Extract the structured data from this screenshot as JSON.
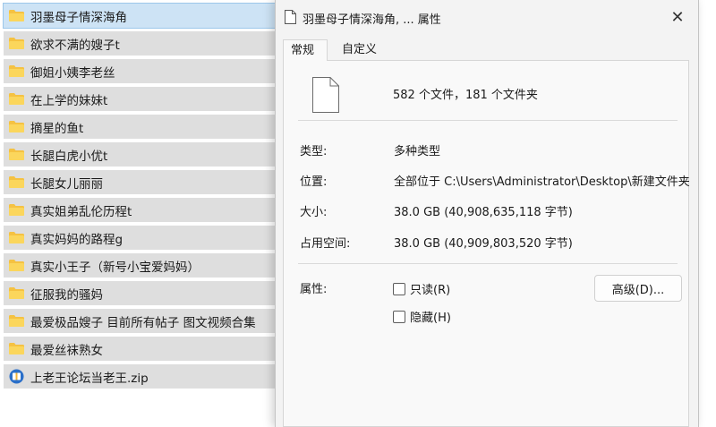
{
  "file_list": [
    {
      "name": "羽墨母子情深海角",
      "type": "folder",
      "selected": true
    },
    {
      "name": "欲求不满的嫂子t",
      "type": "folder"
    },
    {
      "name": "御姐小姨李老丝",
      "type": "folder"
    },
    {
      "name": "在上学的妹妹t",
      "type": "folder"
    },
    {
      "name": "摘星的鱼t",
      "type": "folder"
    },
    {
      "name": "长腿白虎小优t",
      "type": "folder"
    },
    {
      "name": "长腿女儿丽丽",
      "type": "folder"
    },
    {
      "name": "真实姐弟乱伦历程t",
      "type": "folder"
    },
    {
      "name": "真实妈妈的路程g",
      "type": "folder"
    },
    {
      "name": "真实小王子（新号小宝爱妈妈）",
      "type": "folder"
    },
    {
      "name": "征服我的骚妈",
      "type": "folder"
    },
    {
      "name": "最爱极品嫂子 目前所有帖子 图文视频合集",
      "type": "folder"
    },
    {
      "name": "最爱丝袜熟女",
      "type": "folder"
    },
    {
      "name": "上老王论坛当老王.zip",
      "type": "zip"
    }
  ],
  "dialog": {
    "title": "羽墨母子情深海角, ... 属性",
    "close_label": "✕",
    "tabs": {
      "general": "常规",
      "custom": "自定义"
    },
    "summary": "582 个文件，181 个文件夹",
    "type_label": "类型:",
    "type_value": "多种类型",
    "location_label": "位置:",
    "location_value": "全部位于 C:\\Users\\Administrator\\Desktop\\新建文件夹",
    "size_label": "大小:",
    "size_value": "38.0 GB (40,908,635,118 字节)",
    "size_on_disk_label": "占用空间:",
    "size_on_disk_value": "38.0 GB (40,909,803,520 字节)",
    "attributes_label": "属性:",
    "readonly_label": "只读(R)",
    "hidden_label": "隐藏(H)",
    "advanced_label": "高级(D)..."
  },
  "colors": {
    "folder": "#f5c242",
    "selection": "#cde3f5",
    "row": "#dedede",
    "dialog": "#f3f3f3"
  },
  "icons": {
    "folder": "folder-icon",
    "zip": "zip-archive-icon",
    "document": "document-icon",
    "close": "close-icon"
  }
}
